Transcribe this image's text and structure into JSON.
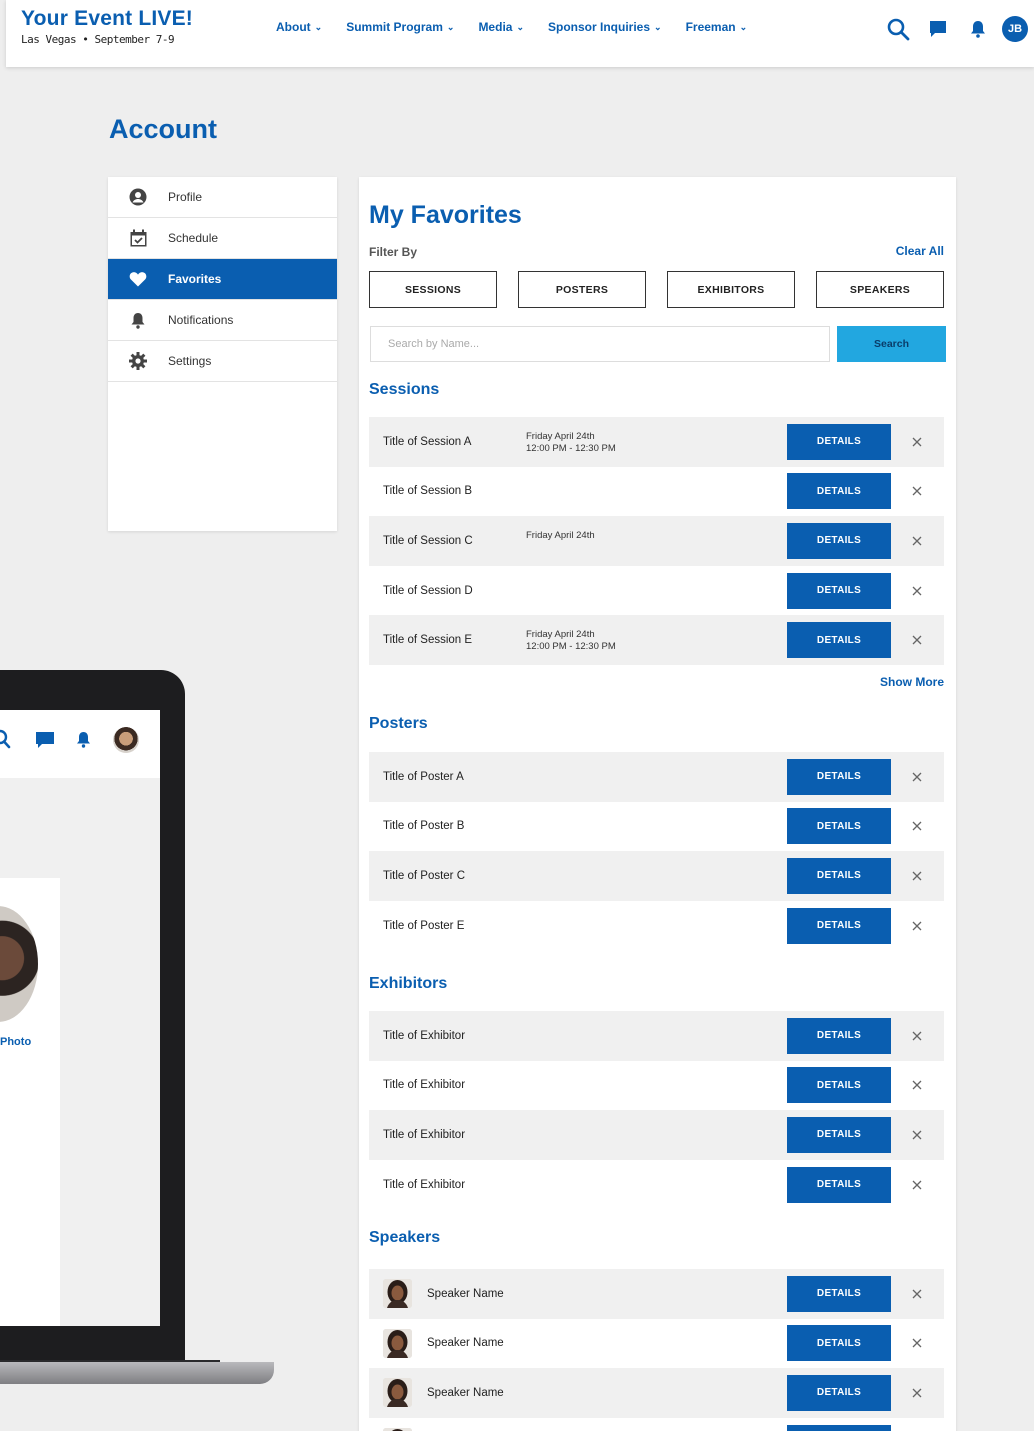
{
  "header": {
    "brand_title": "Your Event LIVE!",
    "brand_subtitle": "Las Vegas • September 7-9",
    "nav": [
      {
        "label": "About"
      },
      {
        "label": "Summit Program"
      },
      {
        "label": "Media"
      },
      {
        "label": "Sponsor Inquiries"
      },
      {
        "label": "Freeman"
      }
    ],
    "icons": [
      "search-icon",
      "chat-icon",
      "bell-icon"
    ],
    "avatar_initials": "JB",
    "accent": "#0a5eb0"
  },
  "account": {
    "title": "Account",
    "sidebar": [
      {
        "label": "Profile",
        "icon": "user-icon",
        "active": false
      },
      {
        "label": "Schedule",
        "icon": "calendar-icon",
        "active": false
      },
      {
        "label": "Favorites",
        "icon": "heart-icon",
        "active": true
      },
      {
        "label": "Notifications",
        "icon": "bell-icon",
        "active": false
      },
      {
        "label": "Settings",
        "icon": "gear-icon",
        "active": false
      }
    ]
  },
  "laptop": {
    "photo_label": "Photo"
  },
  "favorites": {
    "title": "My Favorites",
    "filter_label": "Filter By",
    "clear_all": "Clear All",
    "filters": [
      "SESSIONS",
      "POSTERS",
      "EXHIBITORS",
      "SPEAKERS"
    ],
    "search_placeholder": "Search by Name...",
    "search_button": "Search",
    "details_label": "DETAILS",
    "show_more": "Show More",
    "sessions": {
      "title": "Sessions",
      "items": [
        {
          "name": "Title of Session A",
          "date": "Friday April 24th",
          "time": "12:00 PM - 12:30 PM"
        },
        {
          "name": "Title of Session B",
          "date": "",
          "time": ""
        },
        {
          "name": "Title of Session C",
          "date": "Friday April 24th",
          "time": ""
        },
        {
          "name": "Title of Session D",
          "date": "",
          "time": ""
        },
        {
          "name": "Title of Session E",
          "date": "Friday April 24th",
          "time": "12:00 PM - 12:30 PM"
        }
      ]
    },
    "posters": {
      "title": "Posters",
      "items": [
        "Title of Poster A",
        "Title of Poster B",
        "Title of Poster C",
        "Title of Poster E"
      ]
    },
    "exhibitors": {
      "title": "Exhibitors",
      "items": [
        "Title of Exhibitor",
        "Title of Exhibitor",
        "Title of Exhibitor",
        "Title of Exhibitor"
      ]
    },
    "speakers": {
      "title": "Speakers",
      "items": [
        "Speaker Name",
        "Speaker Name",
        "Speaker Name"
      ]
    }
  }
}
